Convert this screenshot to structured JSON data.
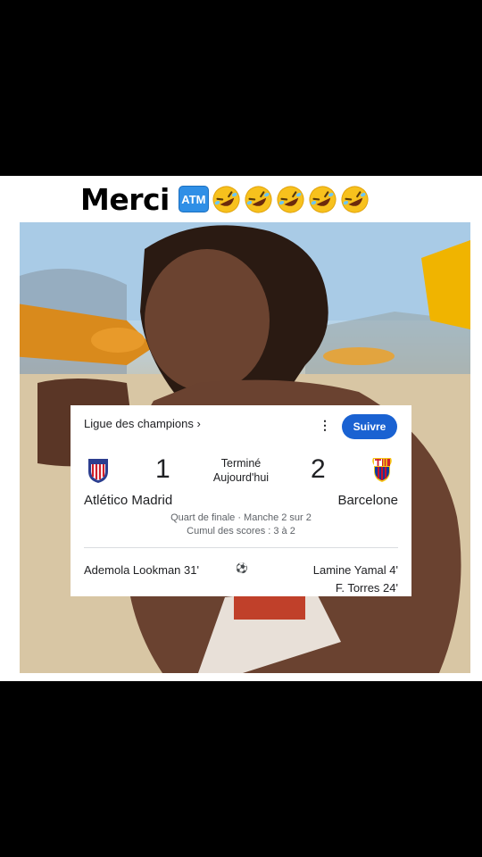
{
  "caption": {
    "text": "Merci",
    "emojis": [
      "atm-icon",
      "rolling-laughing-icon",
      "rolling-laughing-icon",
      "rolling-laughing-icon",
      "rolling-laughing-icon",
      "rolling-laughing-icon"
    ],
    "atm_label": "ATM"
  },
  "card": {
    "league": "Ligue des champions ›",
    "follow_label": "Suivre",
    "status_line1": "Terminé",
    "status_line2": "Aujourd'hui",
    "home": {
      "name": "Atlético Madrid",
      "score": "1"
    },
    "away": {
      "name": "Barcelone",
      "score": "2"
    },
    "round": "Quart de finale · Manche 2 sur 2",
    "aggregate": "Cumul des scores : 3 à 2",
    "home_scorers": [
      "Ademola Lookman 31'"
    ],
    "away_scorers": [
      "Lamine Yamal 4'",
      "F. Torres 24'"
    ]
  },
  "colors": {
    "follow_button": "#1a62d2",
    "background": "#000000"
  }
}
